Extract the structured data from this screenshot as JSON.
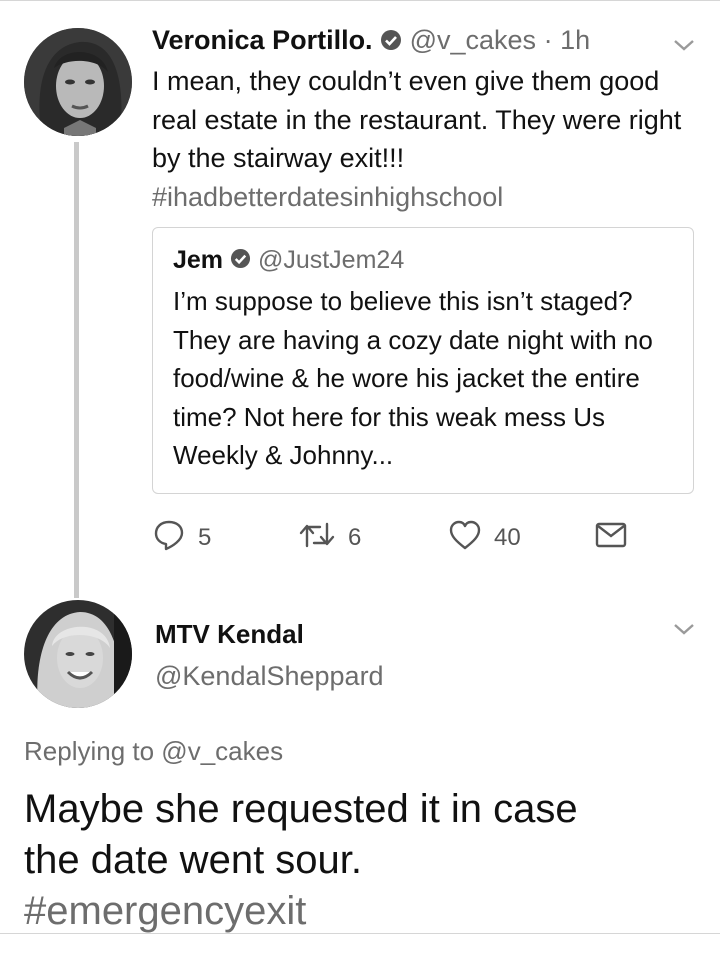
{
  "tweet1": {
    "display_name": "Veronica Portillo.",
    "handle": "@v_cakes",
    "time": "· 1h",
    "text": "I mean, they couldn’t even give them good real estate in the restaurant.  They were right by the stairway exit!!!",
    "hashtag": "#ihadbetterdatesinhighschool",
    "quoted": {
      "display_name": "Jem",
      "handle": "@JustJem24",
      "text": "I’m suppose to believe this isn’t staged? They are having a cozy date night with no food/wine & he wore his jacket the entire time? Not here for this weak mess Us Weekly & Johnny..."
    },
    "actions": {
      "replies": "5",
      "retweets": "6",
      "likes": "40"
    }
  },
  "tweet2": {
    "display_name": "MTV Kendal",
    "handle": "@KendalSheppard",
    "replying_to": "Replying to @v_cakes",
    "text": "Maybe she requested it in case the date went sour.",
    "hashtag": "#emergencyexit"
  },
  "icons": [
    "verified-badge-icon",
    "chevron-down-icon",
    "reply-icon",
    "retweet-icon",
    "like-icon",
    "direct-message-icon"
  ]
}
